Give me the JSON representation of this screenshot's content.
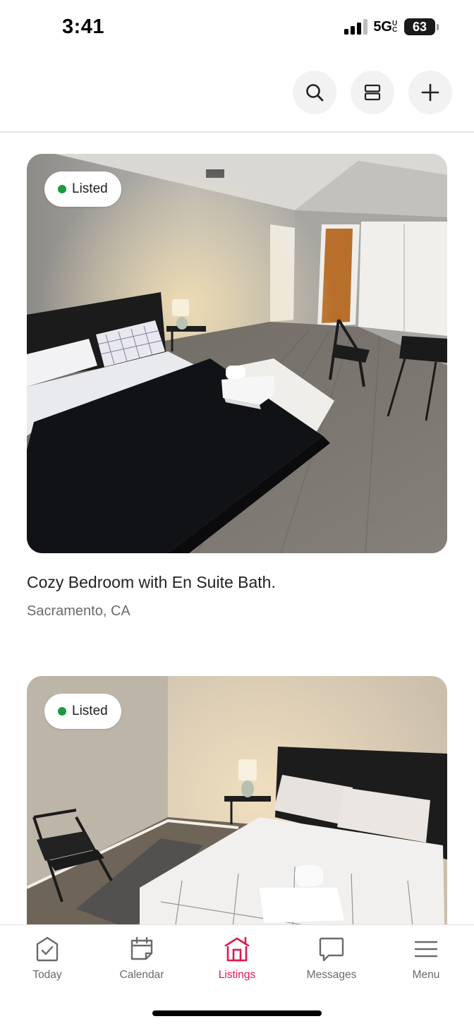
{
  "status_bar": {
    "time": "3:41",
    "network": "5G",
    "network_suffix": "UC",
    "battery": "63"
  },
  "top_actions": [
    {
      "name": "search-button",
      "icon": "search-icon"
    },
    {
      "name": "view-toggle-button",
      "icon": "list-view-icon"
    },
    {
      "name": "add-listing-button",
      "icon": "plus-icon"
    }
  ],
  "listings": [
    {
      "status": "Listed",
      "status_color": "#1b9a3e",
      "title": "Cozy Bedroom with En Suite Bath.",
      "location": "Sacramento, CA"
    },
    {
      "status": "Listed",
      "status_color": "#1b9a3e",
      "title": "",
      "location": ""
    }
  ],
  "tabs": [
    {
      "label": "Today",
      "icon": "today-check-icon",
      "active": false
    },
    {
      "label": "Calendar",
      "icon": "calendar-icon",
      "active": false
    },
    {
      "label": "Listings",
      "icon": "house-icon",
      "active": true
    },
    {
      "label": "Messages",
      "icon": "message-bubble-icon",
      "active": false
    },
    {
      "label": "Menu",
      "icon": "hamburger-menu-icon",
      "active": false
    }
  ],
  "colors": {
    "accent": "#e0184b",
    "listed_green": "#1b9a3e",
    "tab_inactive": "#6a6a6a"
  }
}
